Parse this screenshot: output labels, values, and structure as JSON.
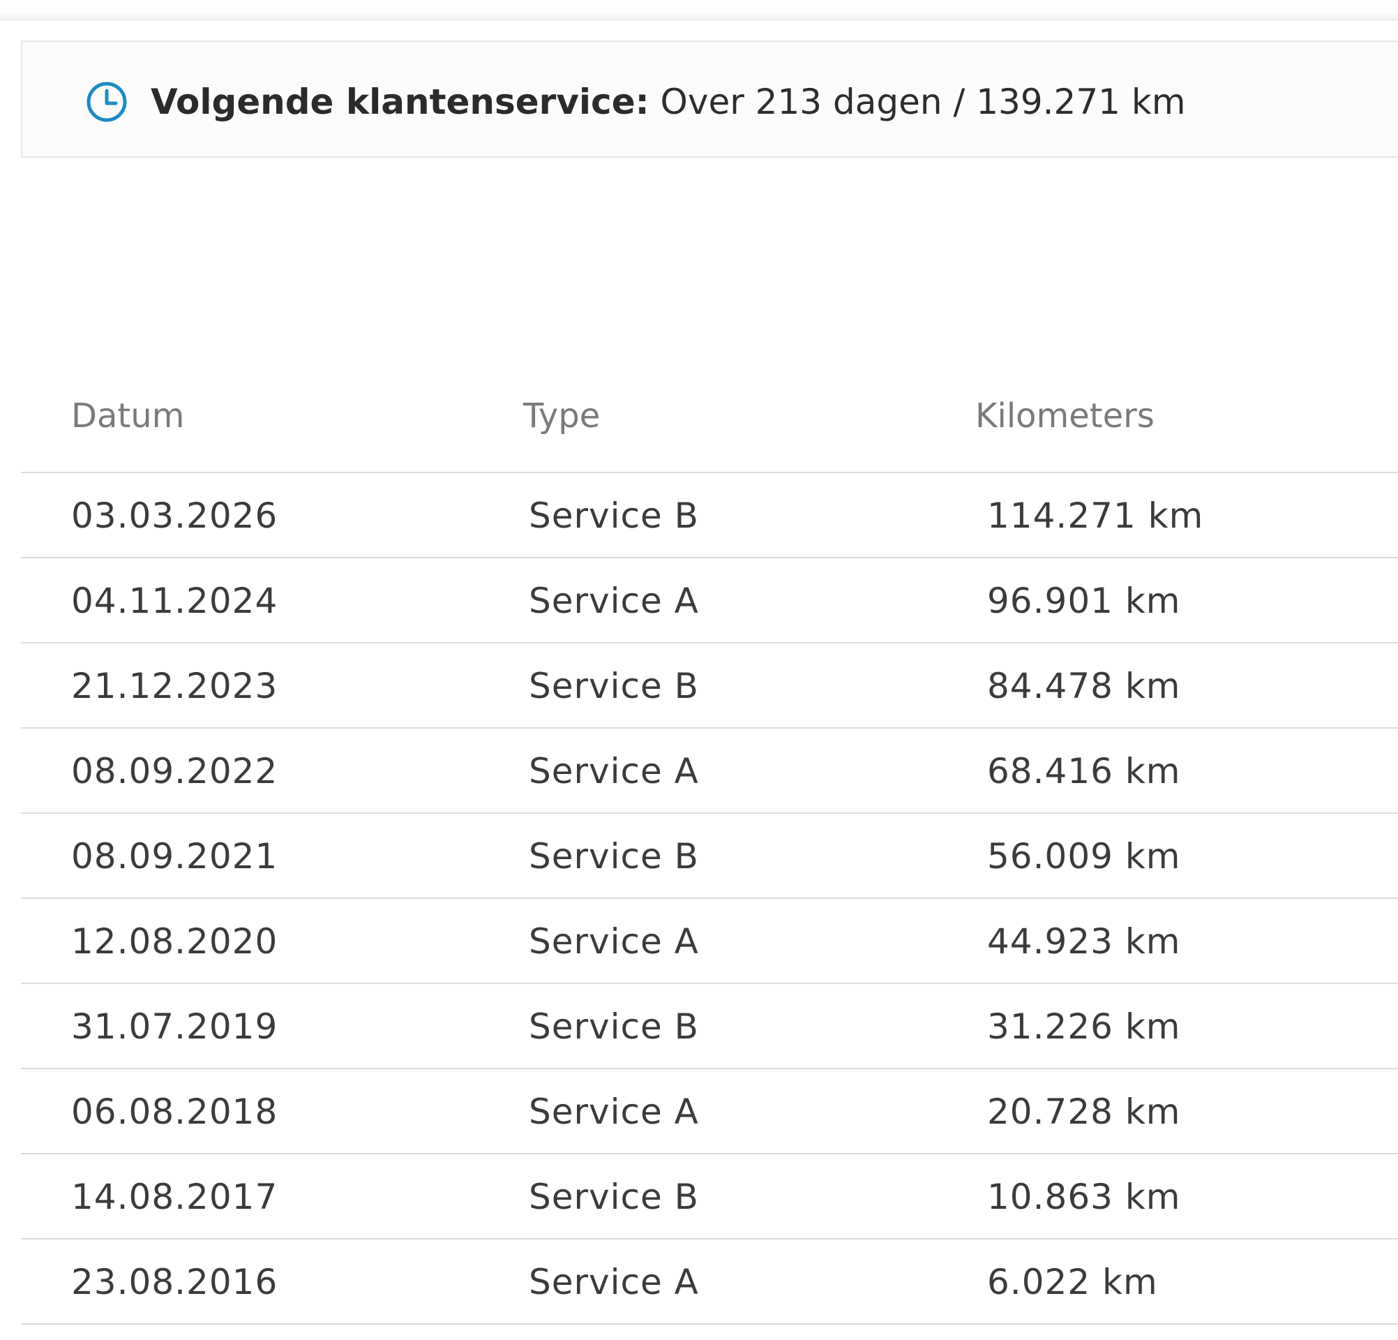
{
  "banner": {
    "label": "Volgende klantenservice:",
    "value": "Over 213 dagen / 139.271 km",
    "icon": "clock-icon",
    "icon_color": "#1a8bc4"
  },
  "table": {
    "headers": {
      "date": "Datum",
      "type": "Type",
      "km": "Kilometers"
    },
    "rows": [
      {
        "date": "03.03.2026",
        "type": "Service B",
        "km": "114.271 km"
      },
      {
        "date": "04.11.2024",
        "type": "Service A",
        "km": "96.901 km"
      },
      {
        "date": "21.12.2023",
        "type": "Service B",
        "km": "84.478 km"
      },
      {
        "date": "08.09.2022",
        "type": "Service A",
        "km": "68.416 km"
      },
      {
        "date": "08.09.2021",
        "type": "Service B",
        "km": "56.009 km"
      },
      {
        "date": "12.08.2020",
        "type": "Service A",
        "km": "44.923 km"
      },
      {
        "date": "31.07.2019",
        "type": "Service B",
        "km": "31.226 km"
      },
      {
        "date": "06.08.2018",
        "type": "Service A",
        "km": "20.728 km"
      },
      {
        "date": "14.08.2017",
        "type": "Service B",
        "km": "10.863 km"
      },
      {
        "date": "23.08.2016",
        "type": "Service A",
        "km": "6.022 km"
      }
    ]
  }
}
